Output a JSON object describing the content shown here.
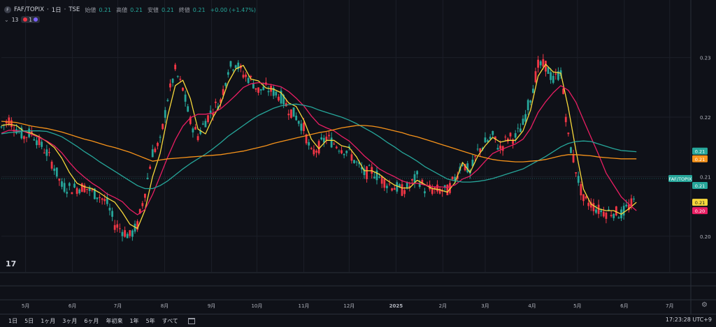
{
  "legend": {
    "symbol_icon": "F",
    "symbol": "FAF/TOPIX",
    "interval": "1日",
    "exchange": "TSE",
    "open_label": "始値",
    "open_value": "0.21",
    "high_label": "高値",
    "high_value": "0.21",
    "low_label": "安値",
    "low_value": "0.21",
    "close_label": "終値",
    "close_value": "0.21",
    "change": "+0.00 (+1.47%)"
  },
  "indicators": {
    "collapse_symbol": "⌄",
    "count": "13",
    "badge_number": "1"
  },
  "price_axis": {
    "ticks": [
      "0.23",
      "0.22",
      "0.21",
      "0.20"
    ],
    "ticks_values": [
      0.23,
      0.22,
      0.21,
      0.2
    ],
    "badges": [
      {
        "text": "0.21",
        "color": "#26a69a",
        "value": 0.2143
      },
      {
        "text": "0.21",
        "color": "#f7931a",
        "value": 0.213
      },
      {
        "text": "FAF/TOPIX",
        "color": "#26a69a",
        "value": 0.2097
      },
      {
        "text": "0.21",
        "color": "#f7d83b",
        "value": 0.2057
      },
      {
        "text": "0.21",
        "color": "#26a69a",
        "value": 0.2097
      },
      {
        "text": "0.20",
        "color": "#e91e63",
        "value": 0.2043
      }
    ]
  },
  "time_axis": {
    "labels": [
      "5月",
      "6月",
      "7月",
      "8月",
      "9月",
      "10月",
      "11月",
      "12月",
      "2025",
      "2月",
      "3月",
      "4月",
      "5月",
      "6月",
      "7月"
    ],
    "label_dates": [
      "2024-05-01",
      "2024-06-01",
      "2024-07-01",
      "2024-08-01",
      "2024-09-01",
      "2024-10-01",
      "2024-11-01",
      "2024-12-01",
      "2025-01-01",
      "2025-02-01",
      "2025-03-01",
      "2025-04-01",
      "2025-05-01",
      "2025-06-01",
      "2025-07-01"
    ]
  },
  "range_buttons": [
    "1日",
    "5日",
    "1ヶ月",
    "3ヶ月",
    "6ヶ月",
    "年初来",
    "1年",
    "5年",
    "すべて"
  ],
  "clock": "17:23:28 UTC+9",
  "tv_logo": "17",
  "colors": {
    "background": "#0f1118",
    "up": "#26a69a",
    "down": "#f23645",
    "ma_yellow": "#f7d83b",
    "ma_pink": "#e91e63",
    "ma_teal": "#26a69a",
    "ma_orange": "#f7931a",
    "grid": "#1c1f29"
  },
  "chart_data": {
    "type": "line",
    "series": [
      {
        "values": [
          0.2186,
          0.2188,
          0.2186,
          0.2176,
          0.2173,
          0.2167,
          0.2159,
          0.2149,
          0.2131,
          0.2107,
          0.2089,
          0.2083,
          0.208,
          0.2073,
          0.2064,
          0.2057,
          0.204,
          0.202,
          0.2013,
          0.2044,
          0.21,
          0.2139,
          0.2202,
          0.2253,
          0.2262,
          0.2231,
          0.218,
          0.2172,
          0.22,
          0.2222,
          0.2258,
          0.2281,
          0.2287,
          0.2264,
          0.2261,
          0.2249,
          0.2247,
          0.2241,
          0.2224,
          0.2218,
          0.2195,
          0.2163,
          0.2147,
          0.2161,
          0.2161,
          0.2152,
          0.2149,
          0.2133,
          0.211,
          0.211,
          0.2104,
          0.2094,
          0.2086,
          0.2081,
          0.2081,
          0.2094,
          0.2087,
          0.208,
          0.2078,
          0.2074,
          0.209,
          0.2124,
          0.2107,
          0.2134,
          0.2152,
          0.2166,
          0.2158,
          0.2161,
          0.2161,
          0.2177,
          0.2212,
          0.2269,
          0.2289,
          0.2276,
          0.2274,
          0.2215,
          0.2144,
          0.2079,
          0.2054,
          0.2046,
          0.2043,
          0.2043,
          0.2037,
          0.2046,
          0.2057
        ]
      },
      {
        "values": [
          0.2173,
          0.2178,
          0.2177,
          0.2176,
          0.2171,
          0.2166,
          0.216,
          0.2152,
          0.214,
          0.2124,
          0.211,
          0.2099,
          0.2089,
          0.2081,
          0.2071,
          0.2065,
          0.2058,
          0.2045,
          0.2036,
          0.2045,
          0.207,
          0.2101,
          0.2133,
          0.2162,
          0.2185,
          0.2199,
          0.2205,
          0.2205,
          0.2207,
          0.2214,
          0.2225,
          0.2237,
          0.225,
          0.2256,
          0.2258,
          0.2256,
          0.2254,
          0.2251,
          0.2243,
          0.2232,
          0.2219,
          0.2202,
          0.2188,
          0.2182,
          0.2177,
          0.2168,
          0.216,
          0.2148,
          0.2135,
          0.2124,
          0.2113,
          0.2106,
          0.21,
          0.2093,
          0.2089,
          0.2089,
          0.2086,
          0.2083,
          0.2083,
          0.2082,
          0.2086,
          0.2096,
          0.2101,
          0.2112,
          0.2126,
          0.2139,
          0.2145,
          0.215,
          0.2155,
          0.2163,
          0.2181,
          0.2208,
          0.2226,
          0.2241,
          0.2253,
          0.2245,
          0.2225,
          0.2195,
          0.2166,
          0.2137,
          0.2106,
          0.2086,
          0.2066,
          0.2054,
          0.2043
        ]
      },
      {
        "values": [
          0.2172,
          0.2174,
          0.2175,
          0.2177,
          0.2177,
          0.2177,
          0.2176,
          0.2172,
          0.2167,
          0.2159,
          0.2151,
          0.2142,
          0.2134,
          0.2125,
          0.2117,
          0.2109,
          0.2101,
          0.2093,
          0.2085,
          0.208,
          0.208,
          0.2085,
          0.2093,
          0.2103,
          0.2113,
          0.2122,
          0.213,
          0.2138,
          0.2147,
          0.2157,
          0.2168,
          0.2177,
          0.2186,
          0.2195,
          0.2203,
          0.2209,
          0.2215,
          0.2219,
          0.2221,
          0.2222,
          0.222,
          0.2217,
          0.2212,
          0.2208,
          0.2204,
          0.22,
          0.2195,
          0.2189,
          0.2182,
          0.2175,
          0.2167,
          0.2158,
          0.215,
          0.2141,
          0.2134,
          0.2126,
          0.2117,
          0.211,
          0.2103,
          0.2096,
          0.2093,
          0.2091,
          0.2091,
          0.2092,
          0.2094,
          0.2097,
          0.2101,
          0.2105,
          0.2109,
          0.2113,
          0.212,
          0.2127,
          0.2134,
          0.2142,
          0.215,
          0.2156,
          0.2159,
          0.216,
          0.2159,
          0.2155,
          0.2151,
          0.2147,
          0.2144,
          0.2143,
          0.2142
        ]
      },
      {
        "values": [
          0.2193,
          0.2192,
          0.2191,
          0.2188,
          0.2185,
          0.2183,
          0.2181,
          0.2178,
          0.2175,
          0.2171,
          0.2167,
          0.2163,
          0.216,
          0.2156,
          0.2152,
          0.2149,
          0.2145,
          0.2141,
          0.2136,
          0.2131,
          0.2126,
          0.2128,
          0.213,
          0.2131,
          0.2132,
          0.2133,
          0.2134,
          0.2135,
          0.2136,
          0.2137,
          0.2139,
          0.2141,
          0.2143,
          0.2146,
          0.2149,
          0.2152,
          0.2156,
          0.2159,
          0.2162,
          0.2165,
          0.2168,
          0.2171,
          0.2174,
          0.2176,
          0.2179,
          0.2182,
          0.2184,
          0.2186,
          0.2186,
          0.2185,
          0.2183,
          0.218,
          0.2177,
          0.2174,
          0.217,
          0.2167,
          0.2163,
          0.2159,
          0.2155,
          0.2151,
          0.2147,
          0.2143,
          0.2139,
          0.2135,
          0.2132,
          0.2129,
          0.2127,
          0.2126,
          0.2125,
          0.2125,
          0.2126,
          0.2127,
          0.2129,
          0.2132,
          0.2135,
          0.2137,
          0.2137,
          0.2136,
          0.2135,
          0.2133,
          0.2132,
          0.2131,
          0.213,
          0.213,
          0.213
        ]
      }
    ],
    "x_start": "2024-04-15",
    "x_step_days": 5,
    "candle_anchor": [
      0.2183,
      0.2196,
      0.2181,
      0.2167,
      0.2175,
      0.2157,
      0.214,
      0.2116,
      0.2084,
      0.2081,
      0.2081,
      0.2083,
      0.2074,
      0.2067,
      0.2055,
      0.202,
      0.201,
      0.2,
      0.2018,
      0.2075,
      0.2141,
      0.2157,
      0.2232,
      0.2278,
      0.2247,
      0.2192,
      0.2169,
      0.2194,
      0.2214,
      0.2227,
      0.2281,
      0.2291,
      0.2272,
      0.2263,
      0.2245,
      0.2248,
      0.2243,
      0.2234,
      0.2214,
      0.2201,
      0.2181,
      0.2138,
      0.215,
      0.2166,
      0.2156,
      0.2148,
      0.2141,
      0.2122,
      0.2105,
      0.211,
      0.2099,
      0.2089,
      0.2083,
      0.2077,
      0.2084,
      0.21,
      0.208,
      0.2078,
      0.2077,
      0.2076,
      0.2097,
      0.2125,
      0.2106,
      0.2142,
      0.2157,
      0.2167,
      0.2147,
      0.2165,
      0.2166,
      0.2188,
      0.2234,
      0.2286,
      0.2287,
      0.2261,
      0.2277,
      0.2165,
      0.2112,
      0.206,
      0.2054,
      0.2044,
      0.204,
      0.2041,
      0.2037,
      0.205,
      0.2061
    ],
    "ylim": [
      0.194,
      0.235
    ],
    "xlim": [
      "2024-04-15",
      "2025-07-15"
    ],
    "grid": true
  }
}
